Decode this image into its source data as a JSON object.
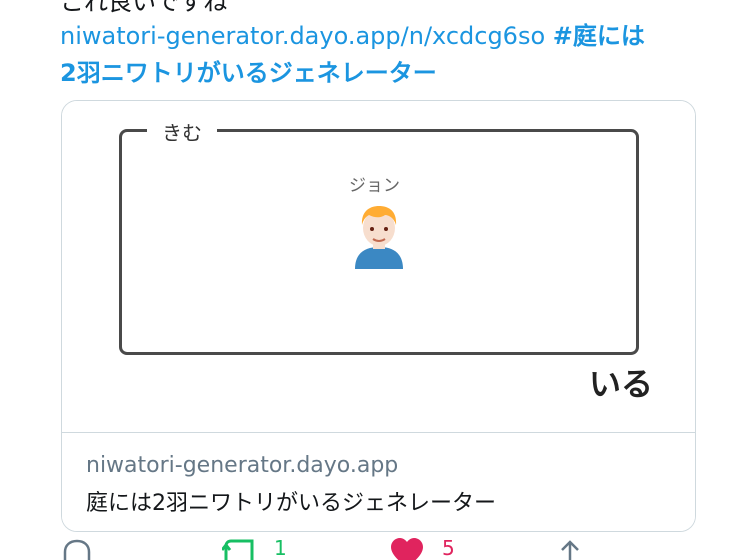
{
  "tweet": {
    "cut_text": "これ良いですね",
    "url": "niwatori-generator.dayo.app/n/xcdcg6so",
    "hashtag_part1": "#庭には",
    "hashtag_part2": "2羽ニワトリがいるジェネレーター"
  },
  "card": {
    "garden_label": "きむ",
    "person_name": "ジョン",
    "person_icon": "man-emoji-icon",
    "suffix": "いる",
    "domain": "niwatori-generator.dayo.app",
    "title": "庭には2羽ニワトリがいるジェネレーター"
  },
  "actions": {
    "reply_icon": "reply-icon",
    "retweet_icon": "retweet-icon",
    "retweet_count": "1",
    "like_icon": "heart-icon",
    "like_count": "5",
    "share_icon": "share-icon",
    "colors": {
      "retweet": "#17bf63",
      "like": "#e0245e",
      "link": "#1b95e0"
    }
  }
}
